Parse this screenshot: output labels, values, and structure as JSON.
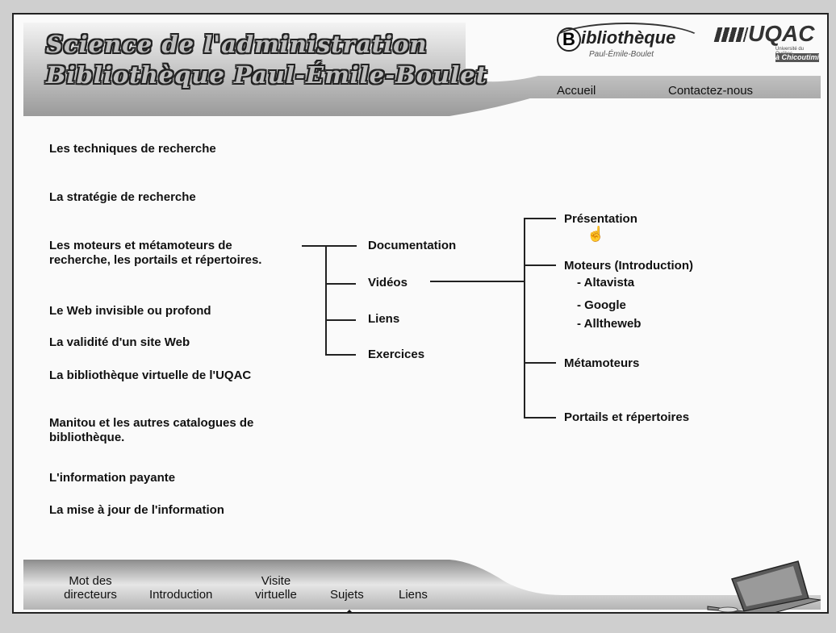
{
  "header": {
    "title_line1": "Science de l'administration",
    "title_line2": "Bibliothèque Paul-Émile-Boulet"
  },
  "library_logo": {
    "letter": "B",
    "name": "ibliothèque",
    "subtitle": "Paul-Émile-Boulet"
  },
  "university_logo": {
    "name": "UQAC",
    "subtitle": "Université du Québec",
    "city": "à Chicoutimi"
  },
  "top_nav": {
    "home": "Accueil",
    "contact": "Contactez-nous"
  },
  "menu": [
    "Les techniques de recherche",
    "La stratégie de recherche",
    "Les moteurs et métamoteurs de recherche, les portails et répertoires.",
    "Le Web invisible ou profond",
    "La validité d'un site Web",
    "La bibliothèque virtuelle de l'UQAC",
    "Manitou et les autres catalogues de bibliothèque.",
    "L'information payante",
    "La mise à jour de l'information"
  ],
  "submenu": [
    "Documentation",
    "Vidéos",
    "Liens",
    "Exercices"
  ],
  "videos_menu": {
    "presentation": "Présentation",
    "engines": "Moteurs (Introduction)",
    "engine_items": [
      "- Altavista",
      "- Google",
      "- Alltheweb"
    ],
    "metaengines": "Métamoteurs",
    "portals": "Portails et répertoires"
  },
  "footer": {
    "directors": "Mot des directeurs",
    "intro": "Introduction",
    "visit": "Visite virtuelle",
    "subjects": "Sujets",
    "links": "Liens"
  },
  "colors": {
    "text": "#111111",
    "background": "#fafafa",
    "accent_gray": "#bdbdbd"
  }
}
